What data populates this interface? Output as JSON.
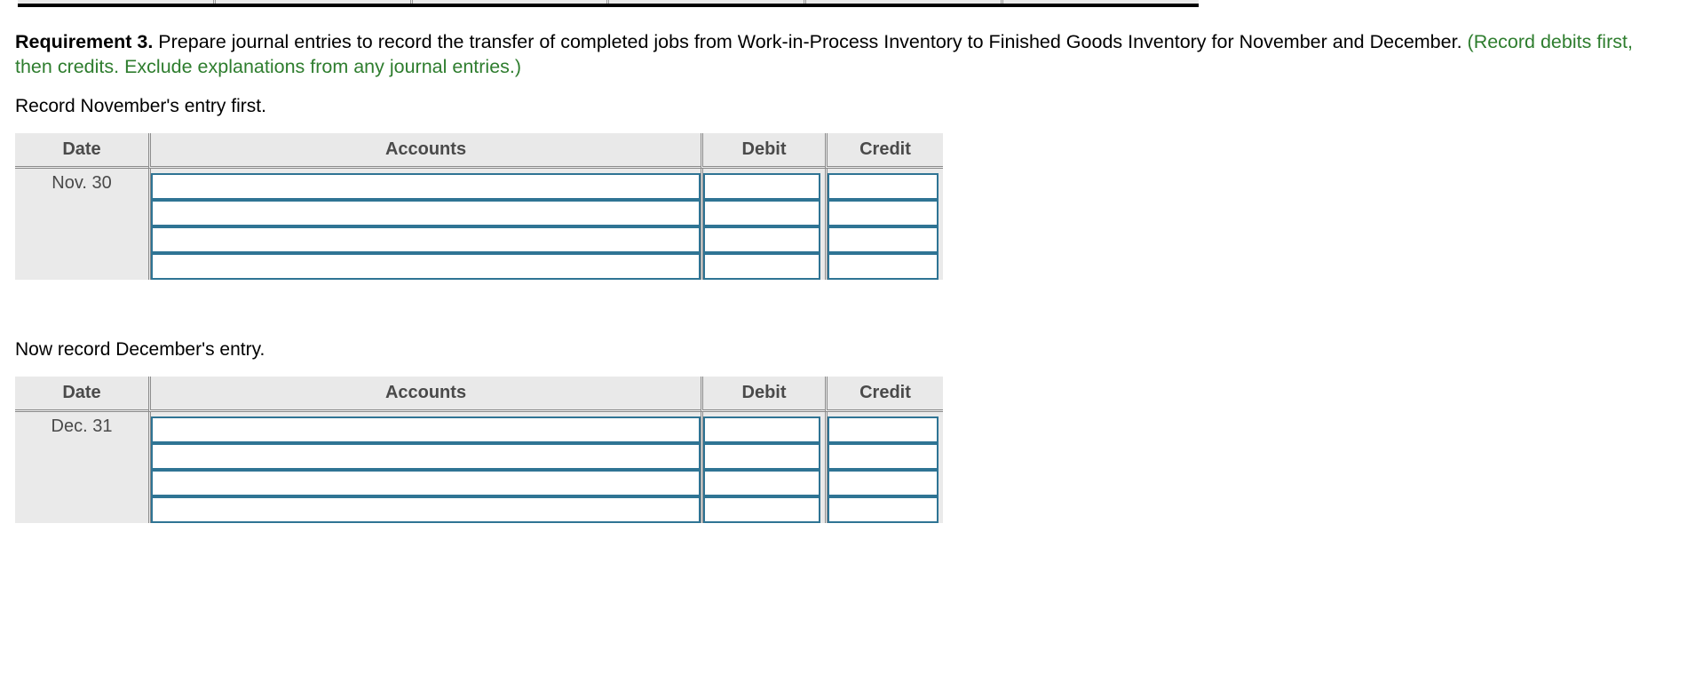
{
  "top_fragment": {
    "visible": true,
    "cells": [
      {
        "label": "...",
        "has_input": false
      },
      {
        "label": "",
        "has_input": true
      },
      {
        "label": "...",
        "has_input": false
      },
      {
        "label": "",
        "has_input": true
      },
      {
        "label": "...",
        "has_input": false
      },
      {
        "label": "",
        "has_input": true
      }
    ]
  },
  "requirement": {
    "lead": "Requirement 3.",
    "body": " Prepare journal entries to record the transfer of completed jobs from Work-in-Process Inventory to Finished Goods Inventory for November and December. ",
    "hint": "(Record debits first, then credits. Exclude explanations from any journal entries.)",
    "hint_color": "#2e7d2e"
  },
  "prompts": {
    "november": "Record November's entry first.",
    "december": "Now record December's entry."
  },
  "tables": {
    "november": {
      "headers": {
        "date": "Date",
        "accounts": "Accounts",
        "debit": "Debit",
        "credit": "Credit"
      },
      "date": "Nov. 30",
      "rows": [
        {
          "accounts": "",
          "debit": "",
          "credit": ""
        },
        {
          "accounts": "",
          "debit": "",
          "credit": ""
        },
        {
          "accounts": "",
          "debit": "",
          "credit": ""
        },
        {
          "accounts": "",
          "debit": "",
          "credit": ""
        }
      ]
    },
    "december": {
      "headers": {
        "date": "Date",
        "accounts": "Accounts",
        "debit": "Debit",
        "credit": "Credit"
      },
      "date": "Dec. 31",
      "rows": [
        {
          "accounts": "",
          "debit": "",
          "credit": ""
        },
        {
          "accounts": "",
          "debit": "",
          "credit": ""
        },
        {
          "accounts": "",
          "debit": "",
          "credit": ""
        },
        {
          "accounts": "",
          "debit": "",
          "credit": ""
        }
      ]
    }
  },
  "colors": {
    "input_border": "#2f7494",
    "table_bg": "#eaeaea",
    "header_text": "#4a4a4a",
    "rule": "#8c8c8c",
    "green_hint": "#2e7d2e"
  }
}
